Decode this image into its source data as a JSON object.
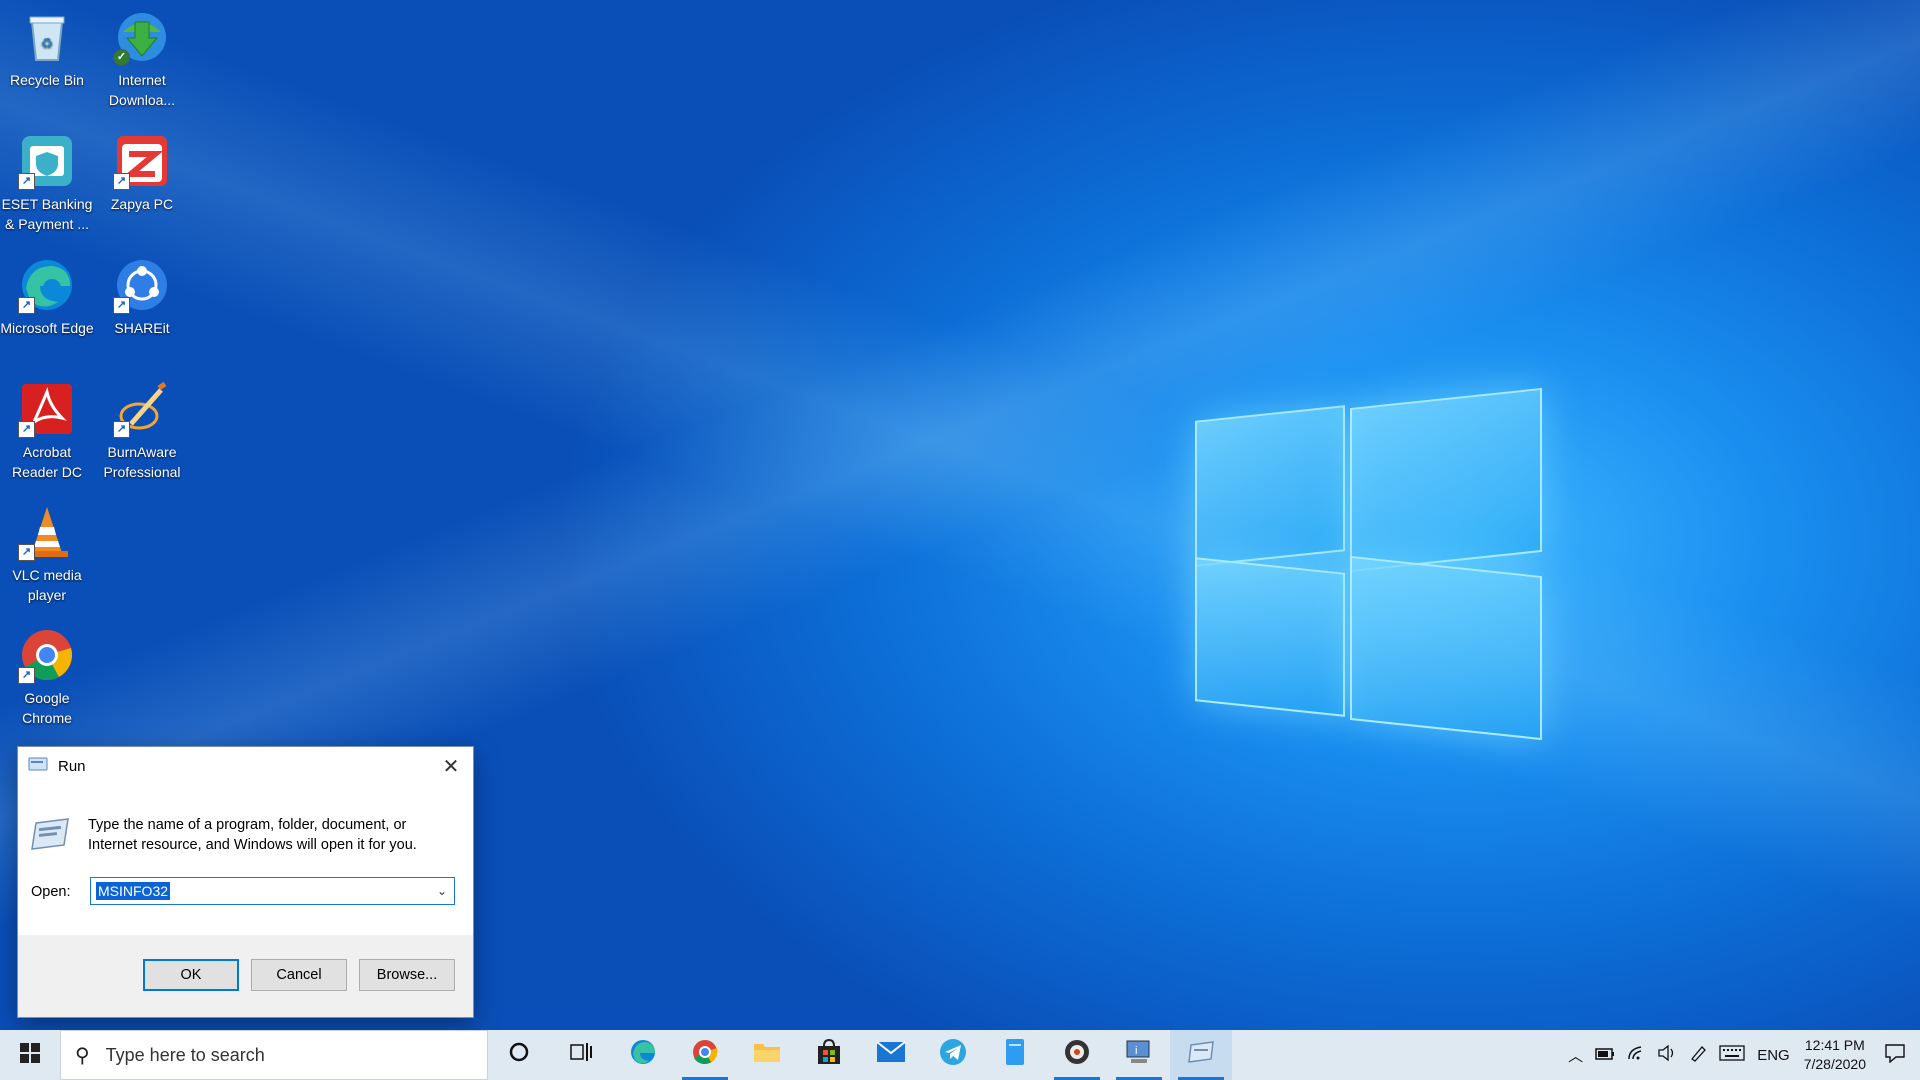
{
  "desktop": {
    "icons": [
      {
        "label": "Recycle Bin",
        "icon": "recycle-bin-icon"
      },
      {
        "label": "Internet Downloa...",
        "icon": "internet-download-manager-icon"
      },
      {
        "label": "ESET Banking & Payment ...",
        "icon": "eset-banking-icon"
      },
      {
        "label": "Zapya PC",
        "icon": "zapya-icon"
      },
      {
        "label": "Microsoft Edge",
        "icon": "edge-icon"
      },
      {
        "label": "SHAREit",
        "icon": "shareit-icon"
      },
      {
        "label": "Acrobat Reader DC",
        "icon": "acrobat-icon"
      },
      {
        "label": "BurnAware Professional",
        "icon": "burnaware-icon"
      },
      {
        "label": "VLC media player",
        "icon": "vlc-icon"
      },
      {
        "label": "Google Chrome",
        "icon": "chrome-icon"
      }
    ]
  },
  "run_dialog": {
    "title": "Run",
    "description": "Type the name of a program, folder, document, or Internet resource, and Windows will open it for you.",
    "open_label": "Open:",
    "open_value": "MSINFO32",
    "ok_label": "OK",
    "cancel_label": "Cancel",
    "browse_label": "Browse..."
  },
  "taskbar": {
    "search_placeholder": "Type here to search",
    "language": "ENG",
    "time": "12:41 PM",
    "date": "7/28/2020"
  },
  "colors": {
    "accent": "#0078d7",
    "taskbar_bg": "#dfe9f2"
  }
}
